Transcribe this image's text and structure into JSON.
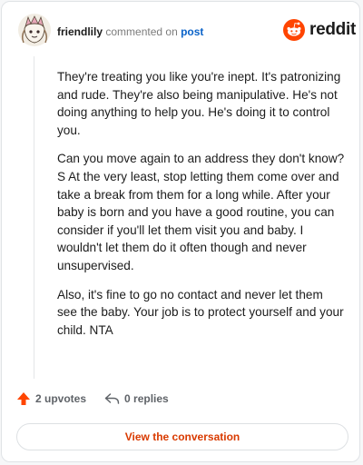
{
  "header": {
    "username": "friendlily",
    "action_text": "commented on",
    "post_link": "post"
  },
  "brand": {
    "name": "reddit"
  },
  "comment": {
    "paragraphs": [
      "They're treating you like you're inept. It's patronizing and rude. They're also being manipulative. He's not doing anything to help you. He's doing it to control you.",
      "Can you move again to an address they don't know? S At the very least, stop letting them come over and take a break from them for a long while. After your baby is born and you have a good routine, you can consider if you'll let them visit you and baby. I wouldn't let them do it often though and never unsupervised.",
      "Also, it's fine to go no contact and never let them see the baby. Your job is to protect yourself and your child. NTA"
    ]
  },
  "actions": {
    "upvotes": "2 upvotes",
    "replies": "0 replies"
  },
  "footer": {
    "view_button": "View the conversation"
  },
  "colors": {
    "accent": "#d93a00",
    "upvote": "#ff4500",
    "link": "#0b63c9"
  },
  "icons": [
    "avatar",
    "reddit-logo-icon",
    "upvote-arrow-icon",
    "reply-icon"
  ]
}
